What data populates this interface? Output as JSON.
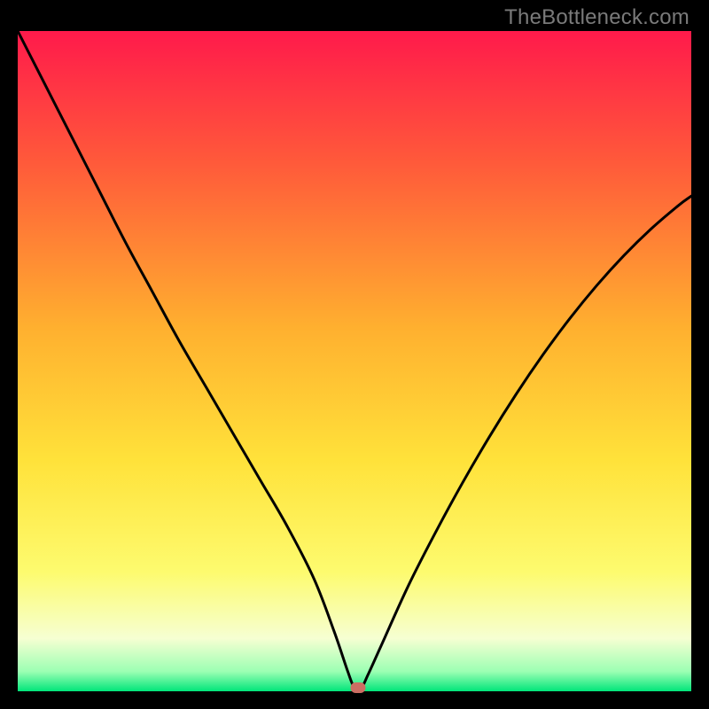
{
  "watermark": "TheBottleneck.com",
  "chart_data": {
    "type": "line",
    "title": "",
    "xlabel": "",
    "ylabel": "",
    "xlim": [
      0,
      100
    ],
    "ylim": [
      0,
      100
    ],
    "grid": false,
    "axes_visible": false,
    "background": {
      "stops": [
        {
          "offset": 0.0,
          "color": "#ff1a4b"
        },
        {
          "offset": 0.2,
          "color": "#ff5a3a"
        },
        {
          "offset": 0.45,
          "color": "#ffb02f"
        },
        {
          "offset": 0.65,
          "color": "#ffe23a"
        },
        {
          "offset": 0.82,
          "color": "#fdfb6f"
        },
        {
          "offset": 0.92,
          "color": "#f6ffd2"
        },
        {
          "offset": 0.97,
          "color": "#9cffb3"
        },
        {
          "offset": 1.0,
          "color": "#00e57a"
        }
      ]
    },
    "series": [
      {
        "name": "bottleneck-curve",
        "color": "#000000",
        "x": [
          0,
          4,
          8,
          12,
          16,
          20,
          24,
          28,
          32,
          36,
          40,
          44,
          47,
          49,
          50,
          51,
          52,
          54,
          58,
          62,
          66,
          70,
          74,
          78,
          82,
          86,
          90,
          94,
          98,
          100
        ],
        "y": [
          100,
          92,
          84,
          76,
          68,
          60.5,
          53,
          46,
          39,
          32,
          25,
          17,
          9,
          3,
          0.5,
          0.5,
          2.5,
          7,
          16,
          24,
          31.5,
          38.5,
          45,
          51,
          56.5,
          61.5,
          66,
          70,
          73.5,
          75
        ]
      }
    ],
    "markers": [
      {
        "name": "optimal-point",
        "x": 50.5,
        "y": 0.6,
        "color": "#cc6e63"
      }
    ]
  }
}
